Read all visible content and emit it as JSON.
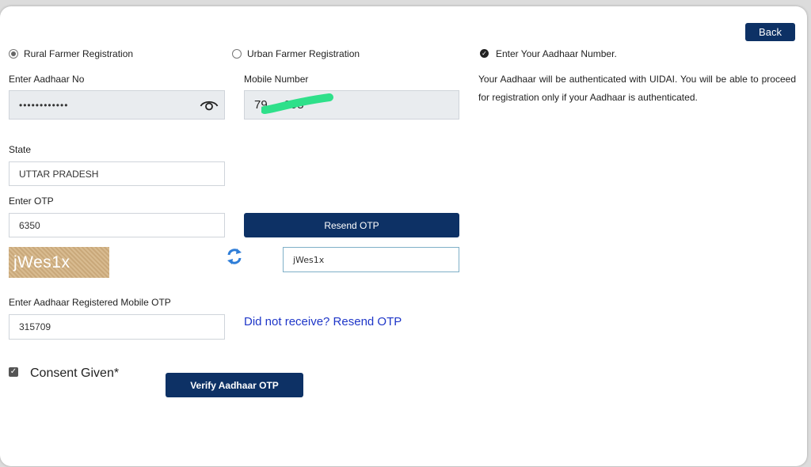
{
  "back_label": "Back",
  "registration": {
    "rural_label": "Rural Farmer Registration",
    "urban_label": "Urban Farmer Registration",
    "selected": "rural"
  },
  "aadhaar": {
    "label": "Enter Aadhaar No",
    "value": "••••••••••••"
  },
  "mobile": {
    "label": "Mobile Number",
    "value": "79     095"
  },
  "state": {
    "label": "State",
    "value": "UTTAR PRADESH"
  },
  "otp": {
    "label": "Enter OTP",
    "value": "6350",
    "resend_label": "Resend OTP"
  },
  "captcha": {
    "image_text": "jWes1x",
    "input_value": "jWes1x"
  },
  "aadhaar_otp": {
    "label": "Enter Aadhaar Registered Mobile OTP",
    "value": "315709",
    "resend_link": "Did not receive? Resend OTP"
  },
  "consent": {
    "label": "Consent Given*",
    "checked": true
  },
  "verify_label": "Verify Aadhaar OTP",
  "info": {
    "heading": "Enter Your Aadhaar Number.",
    "text": "Your Aadhaar will be authenticated with UIDAI. You will be able to proceed for registration only if your Aadhaar is authenticated."
  },
  "colors": {
    "primary_button": "#0d3165",
    "link": "#1e36c8",
    "redaction": "#2ee08a"
  }
}
